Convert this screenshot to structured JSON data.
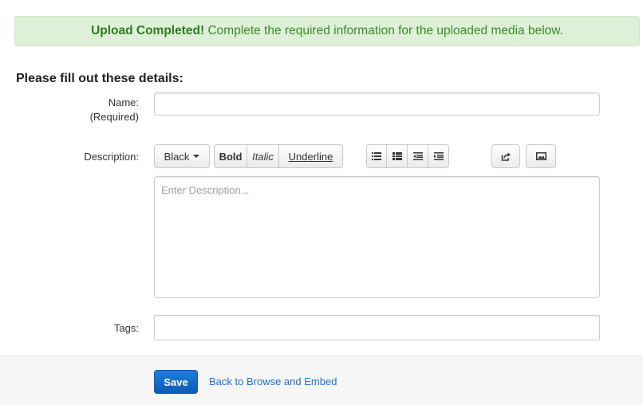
{
  "alert": {
    "strong": "Upload Completed!",
    "text": "Complete the required information for the uploaded media below."
  },
  "form": {
    "heading": "Please fill out these details:",
    "name_label": "Name:",
    "name_required": "(Required)",
    "name_value": "",
    "description_label": "Description:",
    "description_placeholder": "Enter Description...",
    "description_value": "",
    "tags_label": "Tags:",
    "tags_value": ""
  },
  "toolbar": {
    "color": "Black",
    "bold": "Bold",
    "italic": "Italic",
    "underline": "Underline",
    "icons": [
      "unordered-list-icon",
      "ordered-list-icon",
      "outdent-icon",
      "indent-icon",
      "link-icon",
      "image-icon"
    ]
  },
  "footer": {
    "save": "Save",
    "back_link": "Back to Browse and Embed"
  }
}
